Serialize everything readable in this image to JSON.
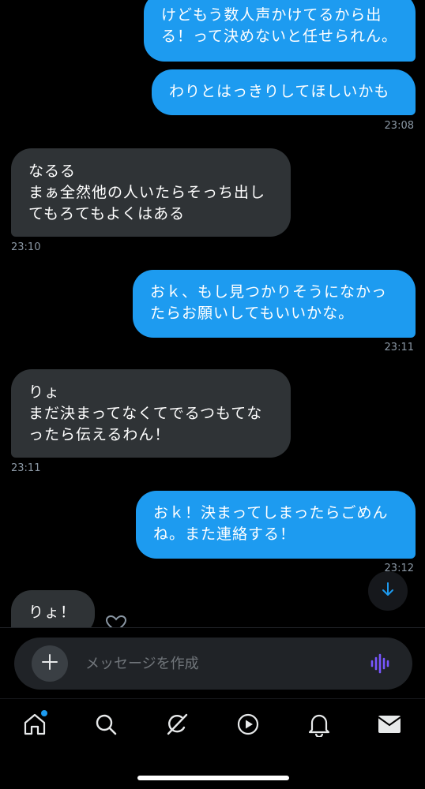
{
  "messages": [
    {
      "dir": "out",
      "text": "けどもう数人声かけてるから出\nる！って決めないと任せられん。"
    },
    {
      "dir": "out",
      "text": "わりとはっきりしてほしいかも",
      "time": "23:08"
    },
    {
      "dir": "in",
      "text": "なるる\nまぁ全然他の人いたらそっち出し\nてもろてもよくはある",
      "time": "23:10"
    },
    {
      "dir": "out",
      "text": "おｋ、もし見つかりそうになかっ\nたらお願いしてもいいかな。",
      "time": "23:11"
    },
    {
      "dir": "in",
      "text": "りょ\nまだ決まってなくてでるつもてな\nったら伝えるわん！",
      "time": "23:11"
    },
    {
      "dir": "out",
      "text": "おｋ！決まってしまったらごめん\nね。また連絡する！",
      "time": "23:12"
    },
    {
      "dir": "in",
      "text": "りょ！"
    }
  ],
  "composer": {
    "placeholder": "メッセージを作成"
  },
  "icons": {
    "scroll_down": "arrow-down-icon",
    "reaction": "heart-add-icon",
    "add": "plus-icon",
    "voice": "audio-wave-icon",
    "tabs": [
      "home-icon",
      "search-icon",
      "grok-icon",
      "play-icon",
      "bell-icon",
      "mail-icon"
    ]
  },
  "colors": {
    "accent": "#1d9bf0",
    "incoming_bubble": "#2f3336",
    "voice_icon": "#7856ff"
  }
}
